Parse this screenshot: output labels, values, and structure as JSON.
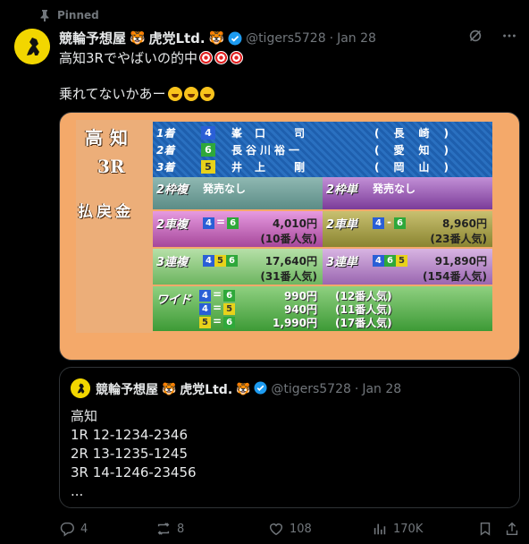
{
  "pinned_label": "Pinned",
  "author": {
    "name": "競輪予想屋",
    "name_suffix": "虎党Ltd.",
    "handle": "@tigers5728",
    "separator": "·",
    "date": "Jan 28"
  },
  "post": {
    "line1": "高知3Rでやばいの的中",
    "line2": "乗れてないかあー"
  },
  "board": {
    "venue": "高知",
    "race": "3R",
    "payout_title": "払戻金",
    "results": [
      {
        "place": "1着",
        "num": "4",
        "name": "峯口 司",
        "pref": "(長崎)"
      },
      {
        "place": "2着",
        "num": "6",
        "name": "長谷川裕一",
        "pref": "(愛知)"
      },
      {
        "place": "3着",
        "num": "5",
        "name": "井上 剛",
        "pref": "(岡山)"
      }
    ],
    "wakufuku": {
      "label": "2枠複",
      "value": "発売なし"
    },
    "wakutan": {
      "label": "2枠単",
      "value": "発売なし"
    },
    "nisyafuku": {
      "label": "2車複",
      "combo": [
        "4",
        "6"
      ],
      "sep": "=",
      "amount": "4,010円",
      "pop": "(10番人気)"
    },
    "nisyatan": {
      "label": "2車単",
      "combo": [
        "4",
        "6"
      ],
      "sep": "-",
      "amount": "8,960円",
      "pop": "(23番人気)"
    },
    "sanfuku": {
      "label": "3連複",
      "combo": [
        "4",
        "5",
        "6"
      ],
      "amount": "17,640円",
      "pop": "(31番人気)"
    },
    "santan": {
      "label": "3連単",
      "combo": [
        "4",
        "6",
        "5"
      ],
      "amount": "91,890円",
      "pop": "(154番人気)"
    },
    "wide": {
      "label": "ワイド",
      "rows": [
        {
          "a": "4",
          "b": "6",
          "sep": "=",
          "amount": "990円",
          "pop": "(12番人気)"
        },
        {
          "a": "4",
          "b": "5",
          "sep": "=",
          "amount": "940円",
          "pop": "(11番人気)"
        },
        {
          "a": "5",
          "b": "6",
          "sep": "=",
          "amount": "1,990円",
          "pop": "(17番人気)"
        }
      ]
    }
  },
  "quote": {
    "name": "競輪予想屋",
    "name_suffix": "虎党Ltd.",
    "handle": "@tigers5728",
    "separator": "·",
    "date": "Jan 28",
    "lines": [
      "高知",
      "1R 12-1234-2346",
      "2R 13-1235-1245",
      "3R 14-1246-23456",
      "..."
    ]
  },
  "actions": {
    "replies": "4",
    "reposts": "8",
    "likes": "108",
    "views": "170K"
  },
  "colors": {
    "accent": "#1d9bf0",
    "muted": "#71767b",
    "text": "#e7e9ea"
  }
}
